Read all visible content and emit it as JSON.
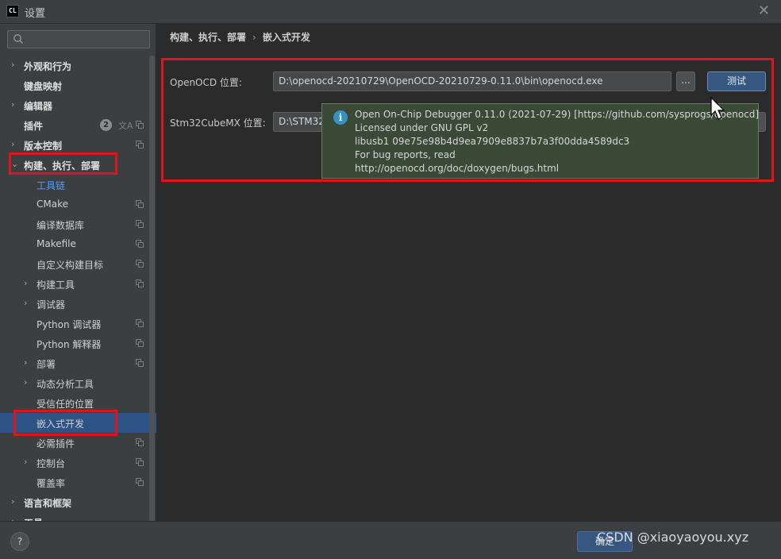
{
  "window": {
    "app_logo": "CL",
    "title": "设置"
  },
  "sidebar": {
    "search": {
      "placeholder": "",
      "value": ""
    },
    "items": [
      {
        "label": "外观和行为",
        "chevron": "›",
        "level": 0,
        "bold": true
      },
      {
        "label": "键盘映射",
        "chevron": "",
        "level": 0,
        "bold": true
      },
      {
        "label": "编辑器",
        "chevron": "›",
        "level": 0,
        "bold": true
      },
      {
        "label": "插件",
        "chevron": "",
        "level": 0,
        "bold": true,
        "badge": "2"
      },
      {
        "label": "版本控制",
        "chevron": "›",
        "level": 0,
        "bold": true
      },
      {
        "label": "构建、执行、部署",
        "chevron": "⌄",
        "level": 0,
        "bold": true
      },
      {
        "label": "工具链",
        "chevron": "",
        "level": 1,
        "link": true
      },
      {
        "label": "CMake",
        "chevron": "",
        "level": 1
      },
      {
        "label": "编译数据库",
        "chevron": "",
        "level": 1
      },
      {
        "label": "Makefile",
        "chevron": "",
        "level": 1
      },
      {
        "label": "自定义构建目标",
        "chevron": "",
        "level": 1
      },
      {
        "label": "构建工具",
        "chevron": "›",
        "level": 1
      },
      {
        "label": "调试器",
        "chevron": "›",
        "level": 1
      },
      {
        "label": "Python 调试器",
        "chevron": "",
        "level": 1
      },
      {
        "label": "Python 解释器",
        "chevron": "",
        "level": 1
      },
      {
        "label": "部署",
        "chevron": "›",
        "level": 1
      },
      {
        "label": "动态分析工具",
        "chevron": "›",
        "level": 1
      },
      {
        "label": "受信任的位置",
        "chevron": "",
        "level": 1
      },
      {
        "label": "嵌入式开发",
        "chevron": "",
        "level": 1,
        "selected": true
      },
      {
        "label": "必需插件",
        "chevron": "",
        "level": 1
      },
      {
        "label": "控制台",
        "chevron": "›",
        "level": 1
      },
      {
        "label": "覆盖率",
        "chevron": "",
        "level": 1
      },
      {
        "label": "语言和框架",
        "chevron": "›",
        "level": 0,
        "bold": true
      },
      {
        "label": "工具",
        "chevron": "›",
        "level": 0,
        "bold": true
      }
    ]
  },
  "breadcrumb": {
    "parent": "构建、执行、部署",
    "separator": "›",
    "current": "嵌入式开发"
  },
  "form": {
    "openocd_label": "OpenOCD 位置:",
    "openocd_value": "D:\\openocd-20210729\\OpenOCD-20210729-0.11.0\\bin\\openocd.exe",
    "browse_label": "...",
    "test_label": "测试",
    "cubemx_label": "Stm32CubeMX 位置:",
    "cubemx_value": "D:\\STM32"
  },
  "popup": {
    "icon": "i",
    "lines": [
      "Open On-Chip Debugger 0.11.0 (2021-07-29) [https://github.com/sysprogs/openocd]",
      "Licensed under GNU GPL v2",
      "libusb1 09e75e98b4d9ea7909e8837b7a3f00dda4589dc3",
      "For bug reports, read",
      "http://openocd.org/doc/doxygen/bugs.html"
    ]
  },
  "bottom": {
    "help_label": "?",
    "ok_label": "确定",
    "watermark": "CSDN @xiaoyaoyou.xyz"
  },
  "colors": {
    "highlight_box": "#e0141b",
    "selected_row": "#2d5286",
    "popup_bg": "#3a4a37",
    "info_icon": "#3592c4"
  }
}
